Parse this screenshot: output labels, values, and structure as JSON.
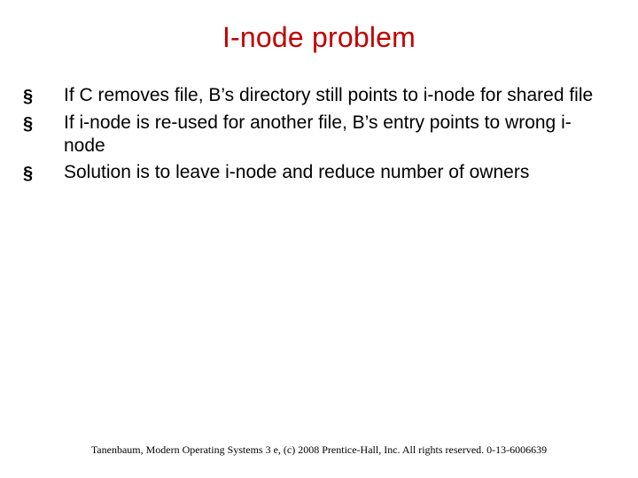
{
  "title": "I-node problem",
  "bullets": [
    "If C removes file, B’s directory still points to i-node for shared file",
    "If i-node is re-used for another file, B’s entry points to wrong i-node",
    "Solution is to leave i-node and reduce number of owners"
  ],
  "bullet_glyph": "§",
  "footer": "Tanenbaum, Modern Operating Systems 3 e, (c) 2008 Prentice-Hall, Inc. All rights reserved. 0-13-6006639"
}
